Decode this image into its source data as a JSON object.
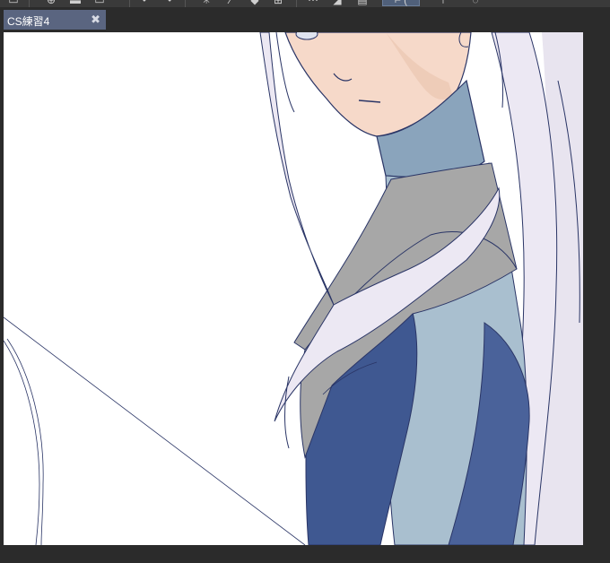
{
  "document": {
    "tab_title": "CS練習4",
    "close_symbol": "✖"
  },
  "toolbar": {
    "icons": [
      "menu-icon",
      "add-layer-icon",
      "layer-icon",
      "undo-icon",
      "redo-icon",
      "sparkle-icon",
      "fill-icon",
      "transform-icon",
      "selection-icon",
      "ruler-icon",
      "snap-icon",
      "text-icon",
      "speech-bubble-icon"
    ]
  },
  "colors": {
    "app_background": "#2b2b2b",
    "tab_active": "#5a6580",
    "canvas": "#ffffff",
    "line_art": "#2a3566",
    "hair": "#ebe7f2",
    "skin": "#f6d9c9",
    "shirt_light": "#a9bfcf",
    "vest_dark": "#3f5891",
    "collar_gray": "#a7a7a7"
  }
}
